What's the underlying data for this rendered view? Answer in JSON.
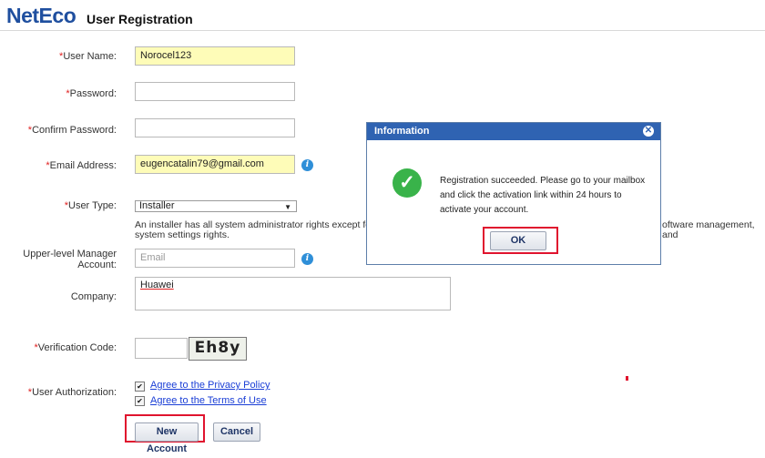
{
  "header": {
    "logo": "NetEco",
    "title": "User Registration"
  },
  "form": {
    "username": {
      "required": "*",
      "label": "User Name:",
      "value": "Norocel123"
    },
    "password": {
      "required": "*",
      "label": "Password:",
      "value": ""
    },
    "confirm_password": {
      "required": "*",
      "label": "Confirm Password:",
      "value": ""
    },
    "email": {
      "required": "*",
      "label": "Email Address:",
      "value": "eugencatalin79@gmail.com"
    },
    "user_type": {
      "required": "*",
      "label": "User Type:",
      "value": "Installer",
      "description_line1": "An installer has all system administrator rights except for",
      "description_tail": "oftware management, and",
      "description_line2": "system settings rights."
    },
    "manager": {
      "label_line1": "Upper-level Manager",
      "label_line2": "Account:",
      "placeholder": "Email"
    },
    "company": {
      "label": "Company:",
      "value": "Huawei"
    },
    "verification": {
      "required": "*",
      "label": "Verification Code:",
      "value": "",
      "captcha_text": "Eh8y"
    },
    "authorization": {
      "required": "*",
      "label": "User Authorization:",
      "privacy_link": "Agree to the Privacy Policy",
      "terms_link": "Agree to the Terms of Use",
      "privacy_checked": true,
      "terms_checked": true
    },
    "new_account_label": "New Account",
    "cancel_label": "Cancel"
  },
  "dialog": {
    "title": "Information",
    "message_line1": "Registration succeeded. Please go to your mailbox",
    "message_line2": "and click the activation link within 24 hours to",
    "message_line3": "activate your account.",
    "ok_label": "OK"
  },
  "icons": {
    "info": "info-icon",
    "success": "check-circle-icon",
    "close": "close-icon",
    "dropdown": "chevron-down-icon"
  },
  "colors": {
    "highlight": "#e0142e",
    "dialog_header": "#2f63b2",
    "filled_field": "#fefcb8",
    "link": "#1a3ed6"
  }
}
